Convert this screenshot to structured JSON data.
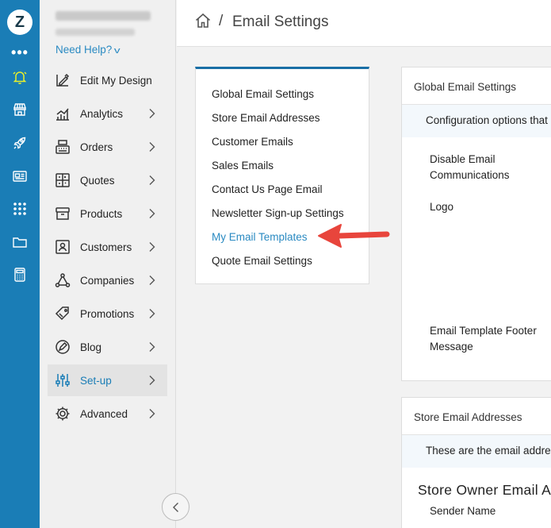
{
  "rail": {
    "logo_text": "Z",
    "more_text": "•••",
    "icons": [
      "bell-icon",
      "store-icon",
      "rocket-icon",
      "news-icon",
      "grid-icon",
      "folder-icon",
      "calculator-icon"
    ],
    "accent": "#1a7db6"
  },
  "nav": {
    "store_name": "Homestead Quilts",
    "store_version": "Version 3.96.1.1",
    "need_help": "Need Help?",
    "items": [
      {
        "label": "Edit My Design",
        "icon": "brush-icon",
        "arrow": false
      },
      {
        "label": "Analytics",
        "icon": "bar-chart-icon",
        "arrow": true
      },
      {
        "label": "Orders",
        "icon": "register-icon",
        "arrow": true
      },
      {
        "label": "Quotes",
        "icon": "quotes-icon",
        "arrow": true
      },
      {
        "label": "Products",
        "icon": "box-icon",
        "arrow": true
      },
      {
        "label": "Customers",
        "icon": "customer-icon",
        "arrow": true
      },
      {
        "label": "Companies",
        "icon": "network-icon",
        "arrow": true
      },
      {
        "label": "Promotions",
        "icon": "tag-icon",
        "arrow": true
      },
      {
        "label": "Blog",
        "icon": "pen-icon",
        "arrow": true
      },
      {
        "label": "Set-up",
        "icon": "sliders-icon",
        "arrow": true,
        "active": true
      },
      {
        "label": "Advanced",
        "icon": "gear-icon",
        "arrow": true
      }
    ]
  },
  "header": {
    "separator": "/",
    "title": "Email Settings"
  },
  "settings_menu": {
    "items": [
      "Global Email Settings",
      "Store Email Addresses",
      "Customer Emails",
      "Sales Emails",
      "Contact Us Page Email",
      "Newsletter Sign-up Settings",
      "My Email Templates",
      "Quote Email Settings"
    ],
    "selected": "My Email Templates",
    "link_color": "#2a8ac2"
  },
  "global_panel": {
    "title": "Global Email Settings",
    "description": "Configuration options that",
    "field_disable": "Disable Email Communications",
    "field_logo": "Logo",
    "field_footer": "Email Template Footer Message"
  },
  "store_panel": {
    "title": "Store Email Addresses",
    "description": "These are the email addre",
    "section_title": "Store Owner Email A",
    "field_sender": "Sender Name"
  },
  "annotation": {
    "arrow_color": "#e8453c"
  }
}
